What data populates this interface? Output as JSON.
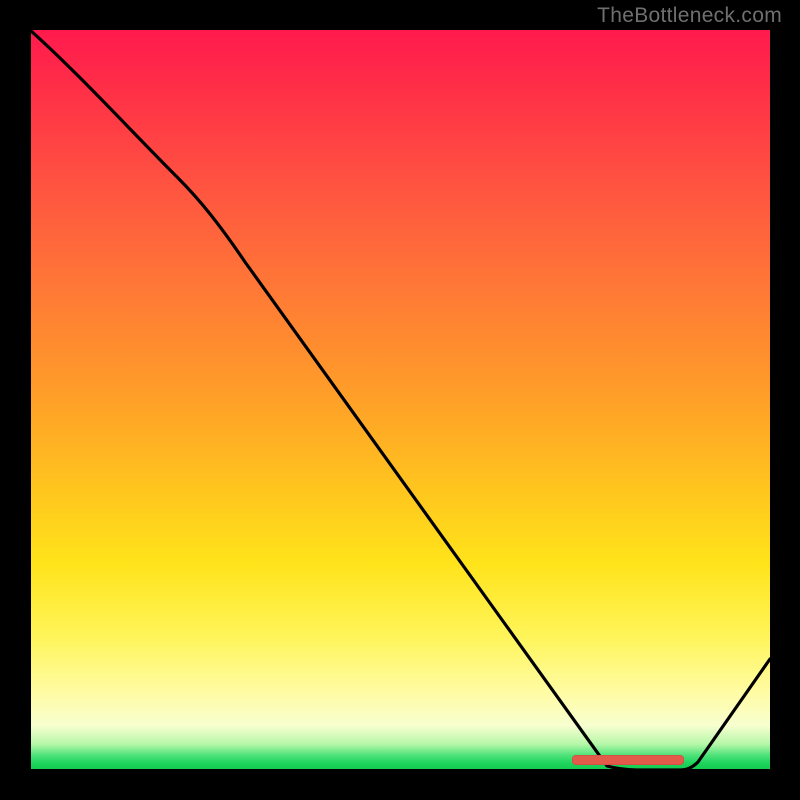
{
  "watermark": "TheBottleneck.com",
  "colors": {
    "background": "#000000",
    "line": "#000000",
    "marker": "#e25a4a",
    "gradient_top": "#ff1a4d",
    "gradient_bottom": "#13c94f"
  },
  "chart_data": {
    "type": "line",
    "title": "",
    "xlabel": "",
    "ylabel": "",
    "xlim": [
      0,
      100
    ],
    "ylim": [
      0,
      100
    ],
    "x": [
      0,
      20,
      78,
      88,
      100
    ],
    "values": [
      100,
      80,
      0,
      0,
      15
    ],
    "annotations": [
      {
        "kind": "marker",
        "x_start": 73,
        "x_end": 88,
        "y": 0
      }
    ],
    "notes": "Gradient background runs red (top, high y) to green (bottom, y≈0). Black curve descends from top-left, has a slight knee near x≈20, reaches y=0 around x≈78–88 (flat valley with salmon marker), then rises to y≈15 at x=100."
  }
}
